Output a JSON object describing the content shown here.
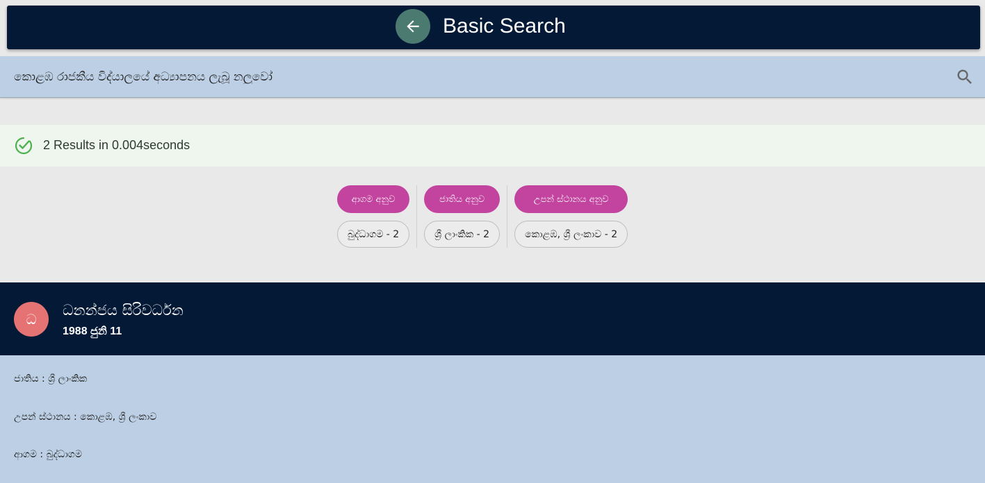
{
  "header": {
    "title": "Basic Search",
    "back_icon": "arrow-left-icon"
  },
  "search": {
    "query": "කොළඹ රාජකීය විද්යාලයේ අධ්‍යාපනය ලැබූ නලුවෝ",
    "icon": "search-icon"
  },
  "results": {
    "text": "2 Results in 0.004seconds",
    "icon": "check-circle-icon",
    "color": "#4caf50"
  },
  "facets": [
    {
      "label": "ආගම අනුව",
      "chip": "බුද්ධාගම - 2"
    },
    {
      "label": "ජාතිය අනුව",
      "chip": "ශ්‍රී ලාංකික - 2"
    },
    {
      "label": "උපන් ස්ථානය අනුව",
      "chip": "කොළඹ, ශ්‍රී ලංකාව - 2"
    }
  ],
  "result_card": {
    "avatar_letter": "ධ",
    "name": "ධනන්ජය සිරිවර්ධන",
    "birth_date": "1988 ජුනි 11",
    "details": [
      {
        "text": "ජාතිය : ශ්‍රී ලාංකික"
      },
      {
        "text": "උපන් ස්ථානය : කොළඹ, ශ්‍රී ලංකාව"
      },
      {
        "text": "ආගම : බුද්ධාගම"
      }
    ]
  },
  "colors": {
    "header_bg": "#031936",
    "accent_pink": "#c2449f",
    "search_bg": "#bccfe4",
    "avatar_bg": "#e57373"
  }
}
